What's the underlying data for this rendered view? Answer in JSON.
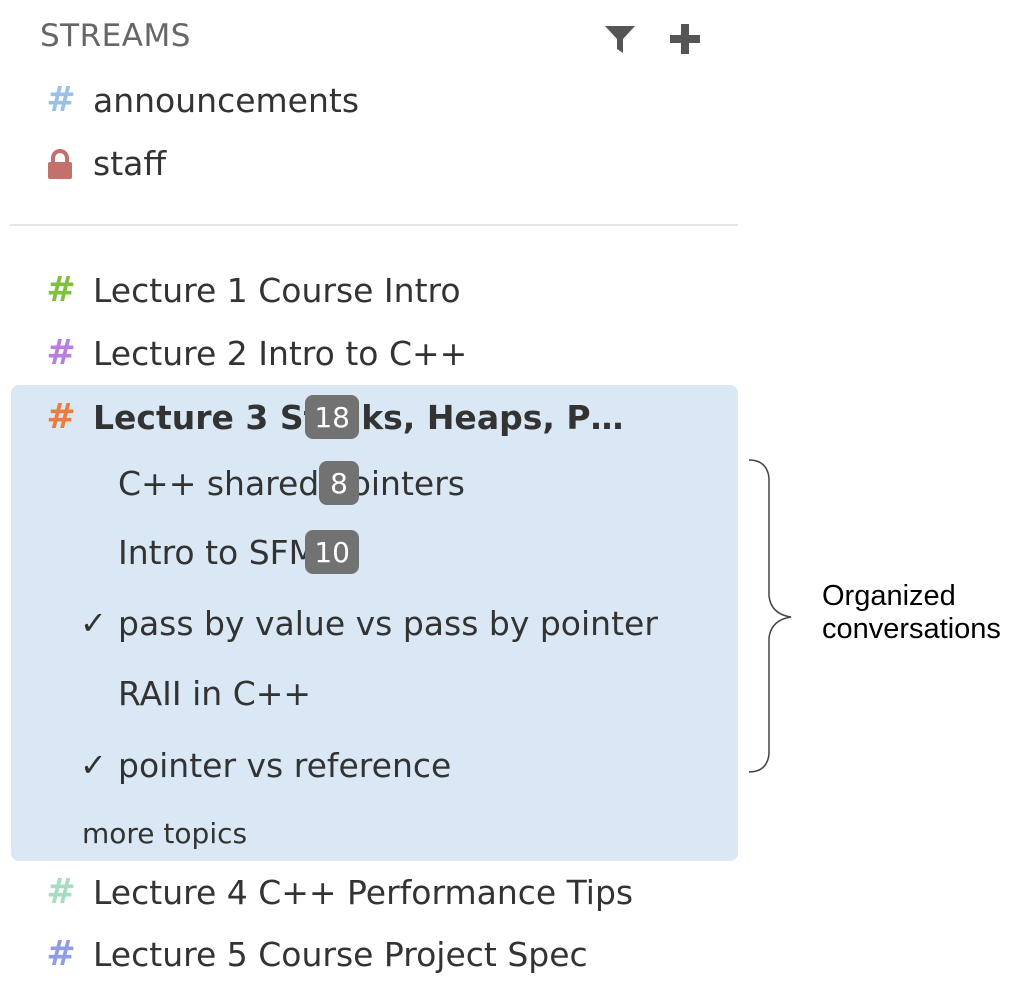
{
  "sidebar": {
    "header": {
      "title": "STREAMS",
      "filter_icon": "filter-icon",
      "add_icon": "plus-icon"
    },
    "pinned_streams": [
      {
        "name": "announcements",
        "icon": "hash-icon",
        "color": "#99c1e7"
      },
      {
        "name": "staff",
        "icon": "lock-icon",
        "color": "#c2726a"
      }
    ],
    "streams": [
      {
        "name": "Lecture 1 Course Intro",
        "color": "#80c040"
      },
      {
        "name": "Lecture 2 Intro to C++",
        "color": "#b87fe0"
      },
      {
        "name": "Lecture 3 Stacks, Heaps, P…",
        "color": "#ee7b3e",
        "unread": "18",
        "active": true
      },
      {
        "name": "Lecture 4 C++ Performance Tips",
        "color": "#a6dcbf"
      },
      {
        "name": "Lecture 5 Course Project Spec",
        "color": "#8e9de6"
      }
    ],
    "topics": [
      {
        "name": "C++ shared pointers",
        "unread": "8"
      },
      {
        "name": "Intro to SFML",
        "unread": "10"
      },
      {
        "name": "pass by value vs pass by pointer",
        "resolved": true
      },
      {
        "name": "RAII in C++"
      },
      {
        "name": "pointer vs reference",
        "resolved": true
      }
    ],
    "more_topics": "more topics",
    "check_glyph": "✓"
  },
  "annotation": {
    "line1": "Organized",
    "line2": "conversations"
  },
  "colors": {
    "active_background": "#d9e8f4",
    "badge_background": "#727272"
  }
}
